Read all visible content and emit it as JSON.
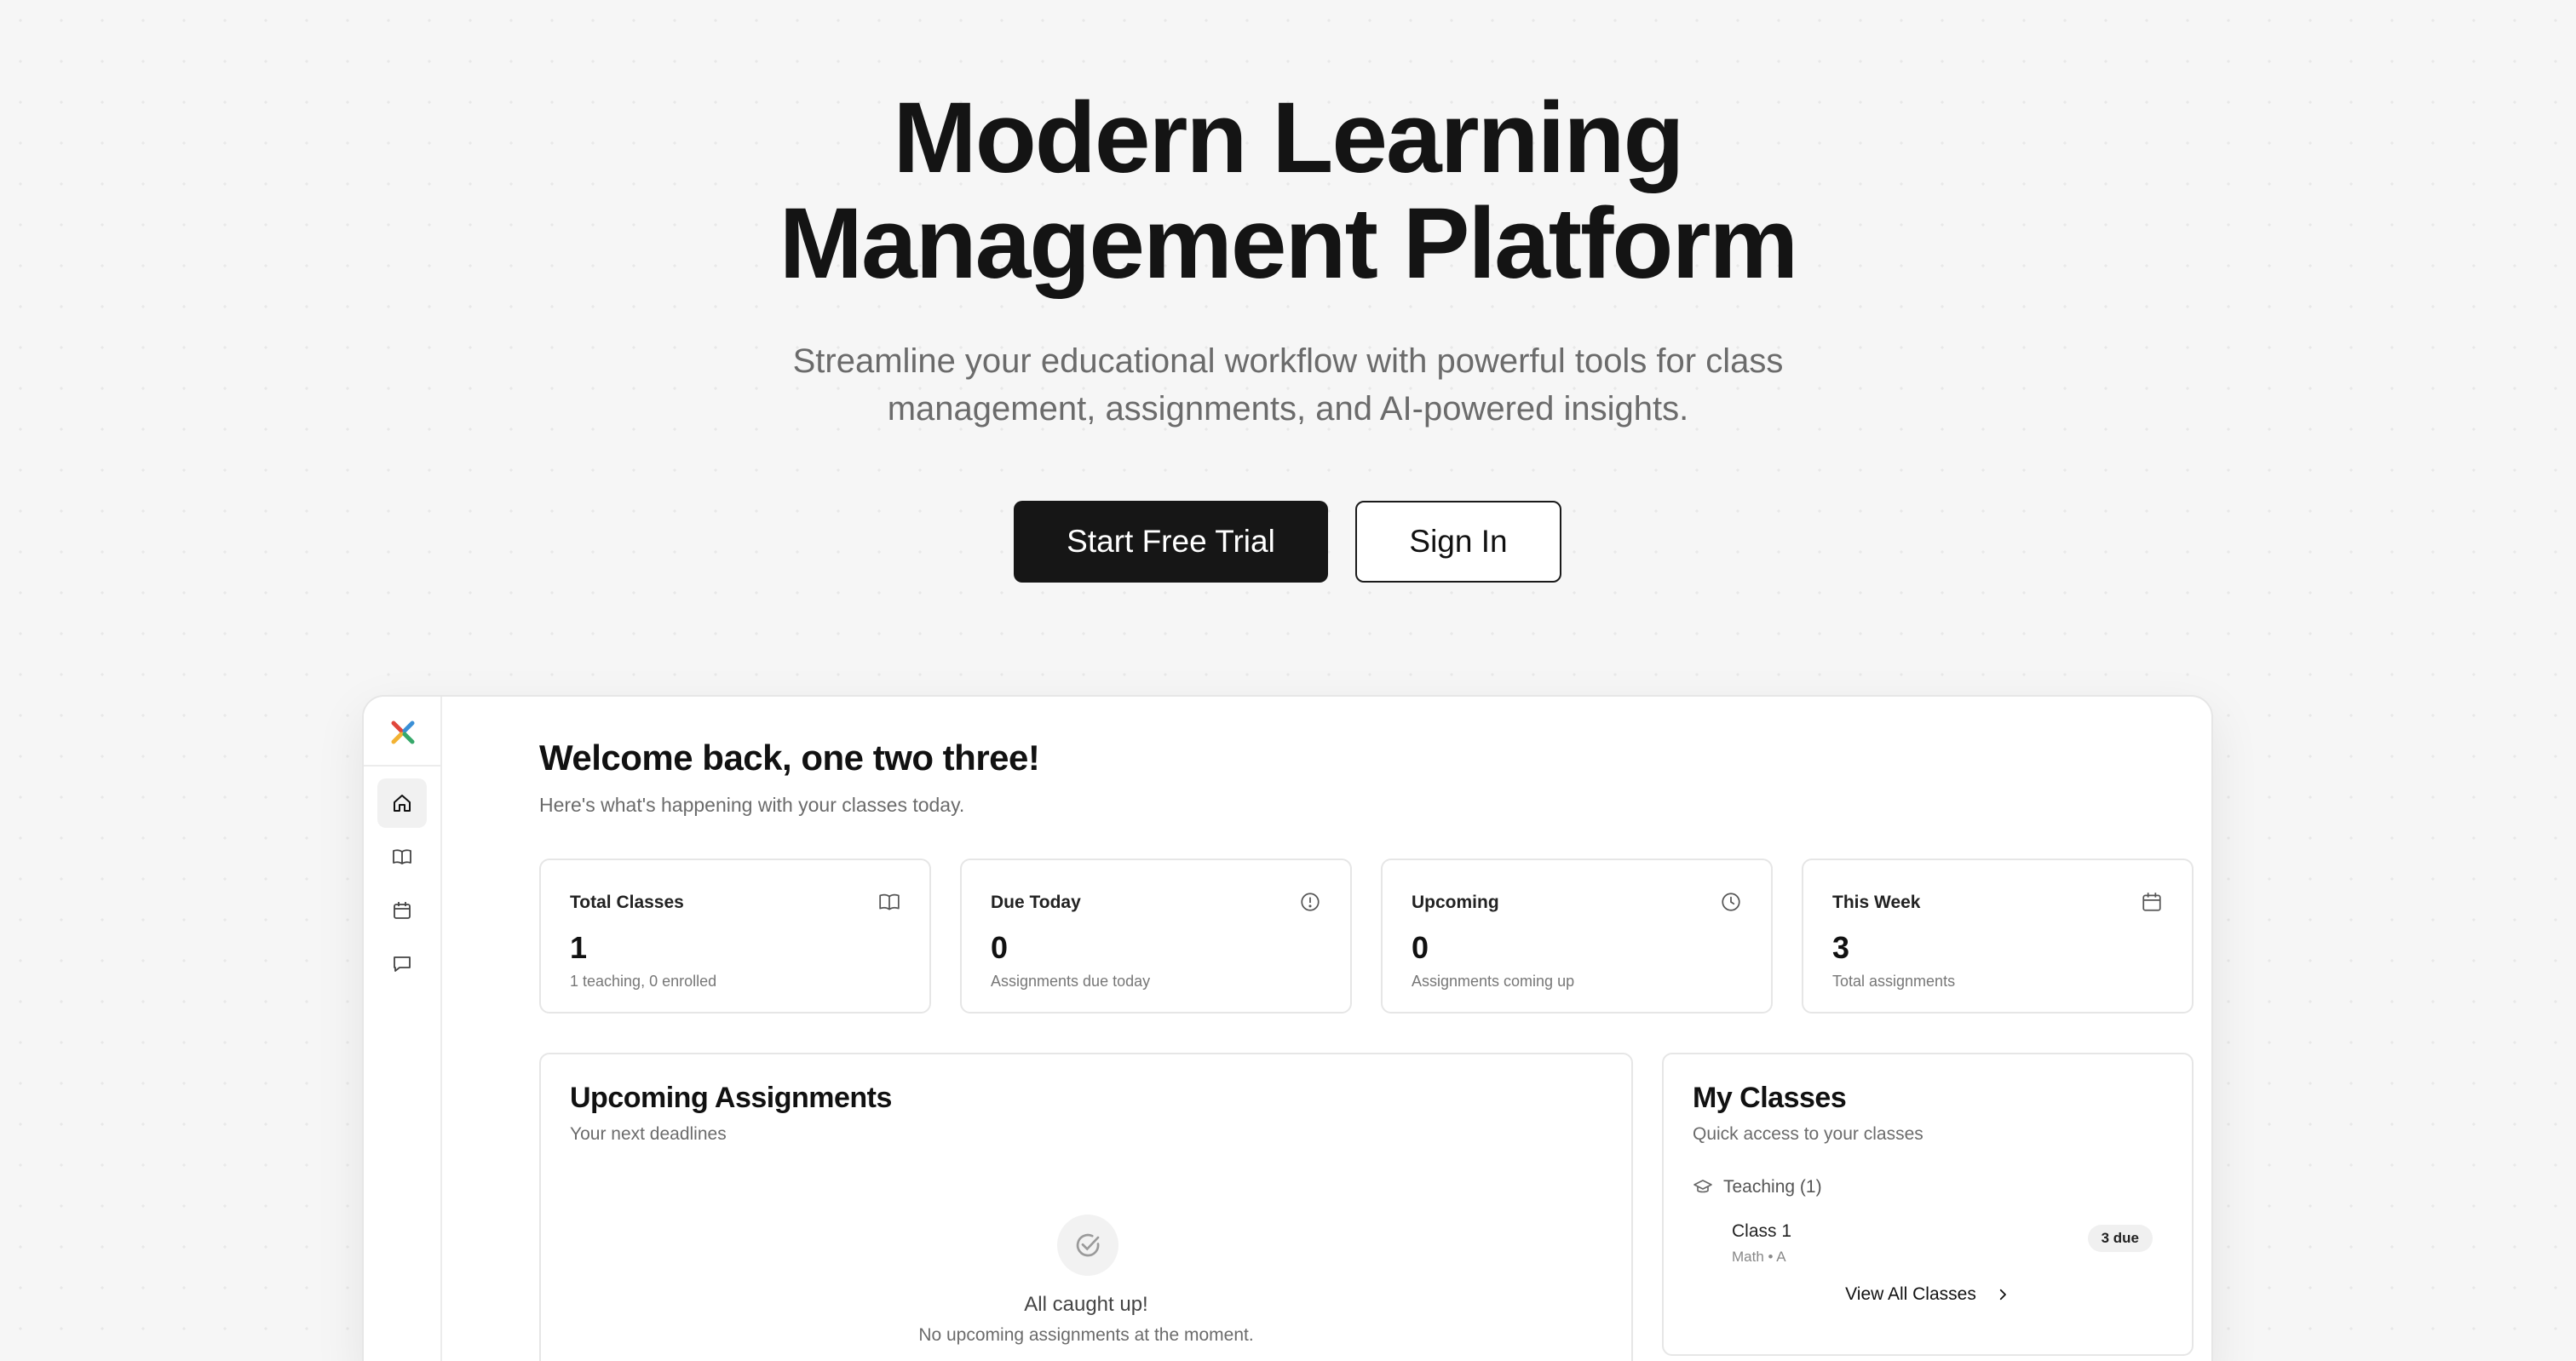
{
  "hero": {
    "title_line1": "Modern Learning",
    "title_line2": "Management Platform",
    "subtitle_line1": "Streamline your educational workflow with powerful tools for class",
    "subtitle_line2": "management, assignments, and AI-powered insights.",
    "primary_button": "Start Free Trial",
    "secondary_button": "Sign In"
  },
  "sidebar": {
    "items": [
      {
        "icon": "home-icon",
        "active": true
      },
      {
        "icon": "book-icon",
        "active": false
      },
      {
        "icon": "calendar-icon",
        "active": false
      },
      {
        "icon": "message-icon",
        "active": false
      }
    ]
  },
  "dashboard": {
    "welcome": "Welcome back, one two three!",
    "welcome_sub": "Here's what's happening with your classes today.",
    "stats": [
      {
        "title": "Total Classes",
        "value": "1",
        "desc": "1 teaching, 0 enrolled",
        "icon": "book-icon"
      },
      {
        "title": "Due Today",
        "value": "0",
        "desc": "Assignments due today",
        "icon": "alert-circle-icon"
      },
      {
        "title": "Upcoming",
        "value": "0",
        "desc": "Assignments coming up",
        "icon": "clock-icon"
      },
      {
        "title": "This Week",
        "value": "3",
        "desc": "Total assignments",
        "icon": "calendar-icon"
      }
    ],
    "upcoming": {
      "title": "Upcoming Assignments",
      "subtitle": "Your next deadlines",
      "empty_title": "All caught up!",
      "empty_sub": "No upcoming assignments at the moment."
    },
    "my_classes": {
      "title": "My Classes",
      "subtitle": "Quick access to your classes",
      "teaching_label": "Teaching (1)",
      "classes": [
        {
          "name": "Class 1",
          "meta": "Math • A",
          "badge": "3 due"
        }
      ],
      "view_all": "View All Classes"
    }
  }
}
